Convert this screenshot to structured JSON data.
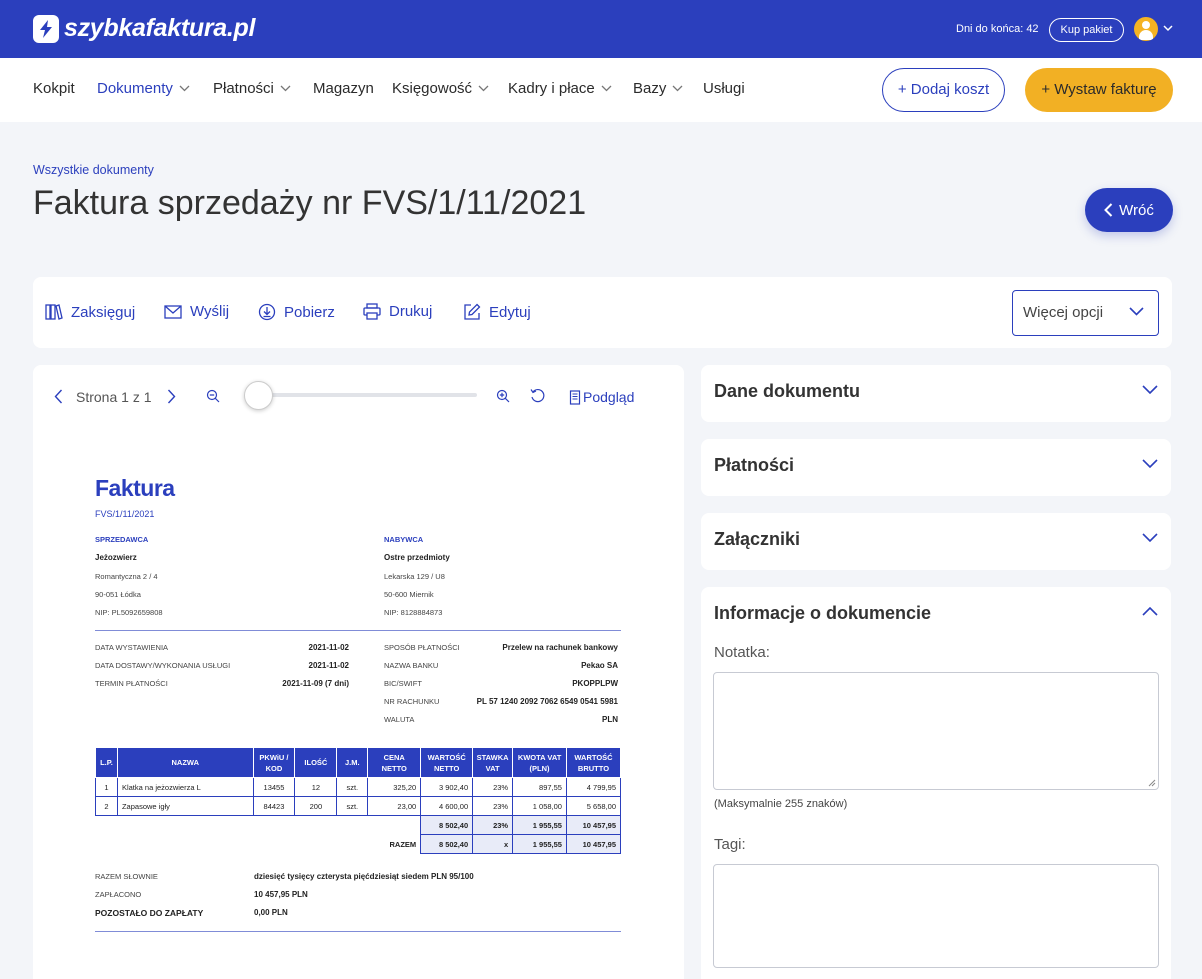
{
  "header": {
    "logo": "szybkafaktura.pl",
    "days_left": "Dni do końca: 42",
    "buy_label": "Kup pakiet"
  },
  "nav": {
    "items": [
      "Kokpit",
      "Dokumenty",
      "Płatności",
      "Magazyn",
      "Księgowość",
      "Kadry i płace",
      "Bazy",
      "Usługi"
    ],
    "add_cost": "+ Dodaj koszt",
    "issue_invoice": "+ Wystaw fakturę"
  },
  "page": {
    "breadcrumb": "Wszystkie dokumenty",
    "title": "Faktura sprzedaży nr FVS/1/11/2021",
    "back": "Wróć"
  },
  "toolbar": {
    "book": "Zaksięguj",
    "send": "Wyślij",
    "download": "Pobierz",
    "print": "Drukuj",
    "edit": "Edytuj",
    "more": "Więcej opcji"
  },
  "viewer": {
    "page_label": "Strona 1 z 1",
    "zoom_level": 0.05,
    "preview": "Podgląd"
  },
  "invoice": {
    "title": "Faktura",
    "number": "FVS/1/11/2021",
    "seller_label": "SPRZEDAWCA",
    "seller_name": "Jeżozwierz",
    "seller_addr1": "Romantyczna 2 / 4",
    "seller_addr2": "90-051 Łódka",
    "seller_nip": "NIP: PL5092659808",
    "buyer_label": "NABYWCA",
    "buyer_name": "Ostre przedmioty",
    "buyer_addr1": "Lekarska 129 / U8",
    "buyer_addr2": "50-600 Miernik",
    "buyer_nip": "NIP: 8128884873",
    "issue_date_label": "DATA WYSTAWIENIA",
    "issue_date": "2021-11-02",
    "delivery_date_label": "DATA DOSTAWY/WYKONANIA USŁUGI",
    "delivery_date": "2021-11-02",
    "due_label": "TERMIN PŁATNOŚCI",
    "due": "2021-11-09 (7 dni)",
    "payment_method_label": "SPOSÓB PŁATNOŚCI",
    "payment_method": "Przelew na rachunek bankowy",
    "bank_label": "NAZWA BANKU",
    "bank": "Pekao SA",
    "swift_label": "BIC/SWIFT",
    "swift": "PKOPPLPW",
    "account_label": "NR RACHUNKU",
    "account": "PL 57 1240 2092 7062 6549 0541 5981",
    "currency_label": "WALUTA",
    "currency": "PLN",
    "columns": [
      "L.P.",
      "NAZWA",
      "PKWiU / KOD",
      "ILOŚĆ",
      "J.M.",
      "CENA NETTO",
      "WARTOŚĆ NETTO",
      "STAWKA VAT",
      "KWOTA VAT (PLN)",
      "WARTOŚĆ BRUTTO"
    ],
    "rows": [
      [
        "1",
        "Klatka na jeżozwierza L",
        "13455",
        "12",
        "szt.",
        "325,20",
        "3 902,40",
        "23%",
        "897,55",
        "4 799,95"
      ],
      [
        "2",
        "Zapasowe igły",
        "84423",
        "200",
        "szt.",
        "23,00",
        "4 600,00",
        "23%",
        "1 058,00",
        "5 658,00"
      ]
    ],
    "subtotal": [
      "8 502,40",
      "23%",
      "1 955,55",
      "10 457,95"
    ],
    "total_label": "RAZEM",
    "total": [
      "8 502,40",
      "x",
      "1 955,55",
      "10 457,95"
    ],
    "in_words_label": "RAZEM SŁOWNIE",
    "in_words": "dziesięć tysięcy czterysta pięćdziesiąt siedem PLN 95/100",
    "paid_label": "ZAPŁACONO",
    "paid": "10 457,95 PLN",
    "remaining_label": "POZOSTAŁO DO ZAPŁATY",
    "remaining": "0,00 PLN"
  },
  "panels": {
    "document_data": "Dane dokumentu",
    "payments": "Płatności",
    "attachments": "Załączniki",
    "info": "Informacje o dokumencie",
    "note_label": "Notatka:",
    "note_value": "",
    "note_hint": "(Maksymalnie 255 znaków)",
    "tags_label": "Tagi:",
    "tags_value": ""
  },
  "colors": {
    "brand": "#2b3fbd",
    "accent": "#f2b024",
    "background": "#f3f5f9"
  }
}
